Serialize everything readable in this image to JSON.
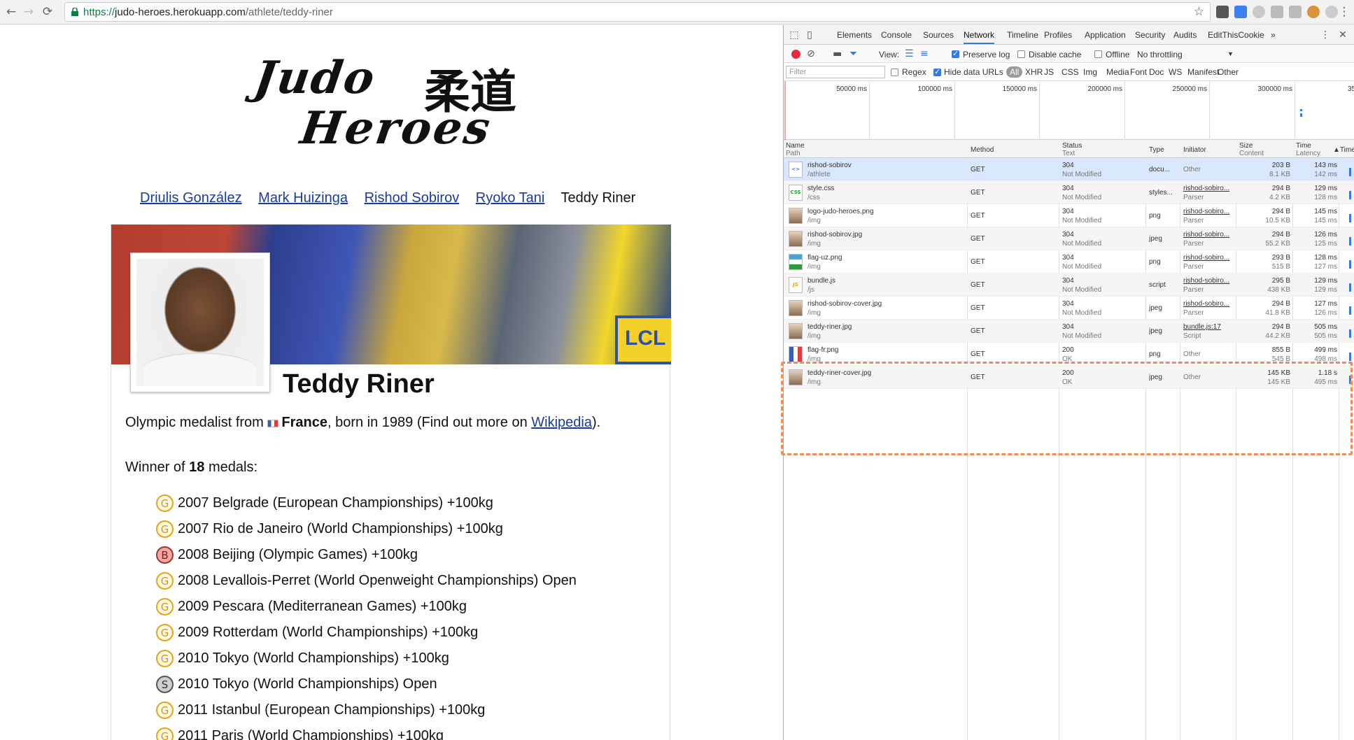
{
  "browser": {
    "url_scheme": "https://",
    "url_host": "judo-heroes.herokuapp.com",
    "url_path": "/athlete/teddy-riner"
  },
  "page": {
    "logo": {
      "line1": "Judo",
      "line2": "Heroes",
      "kanji": "柔道"
    },
    "athlete_links": [
      "Driulis González",
      "Mark Huizinga",
      "Rishod Sobirov",
      "Ryoko Tani"
    ],
    "current_athlete": "Teddy Riner",
    "cover_banner_text": "LCL",
    "name": "Teddy Riner",
    "intro": {
      "prefix": "Olympic medalist from",
      "country": "France",
      "middle": ", born in 1989 (Find out more on",
      "link": "Wikipedia",
      "suffix": ")."
    },
    "winner": {
      "prefix": "Winner of",
      "count": "18",
      "suffix": "medals:"
    },
    "medals": [
      {
        "type": "G",
        "text": "2007 Belgrade (European Championships) +100kg"
      },
      {
        "type": "G",
        "text": "2007 Rio de Janeiro (World Championships) +100kg"
      },
      {
        "type": "B",
        "text": "2008 Beijing (Olympic Games) +100kg"
      },
      {
        "type": "G",
        "text": "2008 Levallois-Perret (World Openweight Championships) Open"
      },
      {
        "type": "G",
        "text": "2009 Pescara (Mediterranean Games) +100kg"
      },
      {
        "type": "G",
        "text": "2009 Rotterdam (World Championships) +100kg"
      },
      {
        "type": "G",
        "text": "2010 Tokyo (World Championships) +100kg"
      },
      {
        "type": "S",
        "text": "2010 Tokyo (World Championships) Open"
      },
      {
        "type": "G",
        "text": "2011 Istanbul (European Championships) +100kg"
      },
      {
        "type": "G",
        "text": "2011 Paris (World Championships) +100kg"
      }
    ]
  },
  "devtools": {
    "tabs": [
      "Elements",
      "Console",
      "Sources",
      "Network",
      "Timeline",
      "Profiles",
      "Application",
      "Security",
      "Audits",
      "EditThisCookie"
    ],
    "active_tab": "Network",
    "more_tabs": "»",
    "toolbar": {
      "view_label": "View:",
      "preserve_log": "Preserve log",
      "disable_cache": "Disable cache",
      "offline": "Offline",
      "throttling": "No throttling"
    },
    "filter": {
      "placeholder": "Filter",
      "regex": "Regex",
      "hide_data_urls": "Hide data URLs",
      "types": [
        "All",
        "XHR",
        "JS",
        "CSS",
        "Img",
        "Media",
        "Font",
        "Doc",
        "WS",
        "Manifest",
        "Other"
      ]
    },
    "timeline_ticks": [
      "50000 ms",
      "100000 ms",
      "150000 ms",
      "200000 ms",
      "250000 ms",
      "300000 ms",
      "35"
    ],
    "columns": {
      "name": "Name",
      "path": "Path",
      "method": "Method",
      "status": "Status",
      "text": "Text",
      "type": "Type",
      "initiator": "Initiator",
      "size": "Size",
      "content": "Content",
      "time": "Time",
      "latency": "Latency",
      "timeline": "Time"
    },
    "requests": [
      {
        "name": "rishod-sobirov",
        "path": "/athlete",
        "method": "GET",
        "status": "304",
        "status_text": "Not Modified",
        "type": "docu...",
        "initiator": "Other",
        "initiator_sub": "",
        "size": "203 B",
        "content": "8.1 KB",
        "time": "143 ms",
        "latency": "142 ms",
        "icon": "doc"
      },
      {
        "name": "style.css",
        "path": "/css",
        "method": "GET",
        "status": "304",
        "status_text": "Not Modified",
        "type": "styles...",
        "initiator": "rishod-sobiro...",
        "initiator_sub": "Parser",
        "size": "294 B",
        "content": "4.2 KB",
        "time": "129 ms",
        "latency": "128 ms",
        "icon": "css"
      },
      {
        "name": "logo-judo-heroes.png",
        "path": "/img",
        "method": "GET",
        "status": "304",
        "status_text": "Not Modified",
        "type": "png",
        "initiator": "rishod-sobiro...",
        "initiator_sub": "Parser",
        "size": "294 B",
        "content": "10.5 KB",
        "time": "145 ms",
        "latency": "145 ms",
        "icon": "img"
      },
      {
        "name": "rishod-sobirov.jpg",
        "path": "/img",
        "method": "GET",
        "status": "304",
        "status_text": "Not Modified",
        "type": "jpeg",
        "initiator": "rishod-sobiro...",
        "initiator_sub": "Parser",
        "size": "294 B",
        "content": "55.2 KB",
        "time": "126 ms",
        "latency": "125 ms",
        "icon": "img"
      },
      {
        "name": "flag-uz.png",
        "path": "/img",
        "method": "GET",
        "status": "304",
        "status_text": "Not Modified",
        "type": "png",
        "initiator": "rishod-sobiro...",
        "initiator_sub": "Parser",
        "size": "293 B",
        "content": "515 B",
        "time": "128 ms",
        "latency": "127 ms",
        "icon": "flag-uz"
      },
      {
        "name": "bundle.js",
        "path": "/js",
        "method": "GET",
        "status": "304",
        "status_text": "Not Modified",
        "type": "script",
        "initiator": "rishod-sobiro...",
        "initiator_sub": "Parser",
        "size": "295 B",
        "content": "438 KB",
        "time": "129 ms",
        "latency": "129 ms",
        "icon": "js"
      },
      {
        "name": "rishod-sobirov-cover.jpg",
        "path": "/img",
        "method": "GET",
        "status": "304",
        "status_text": "Not Modified",
        "type": "jpeg",
        "initiator": "rishod-sobiro...",
        "initiator_sub": "Parser",
        "size": "294 B",
        "content": "41.8 KB",
        "time": "127 ms",
        "latency": "126 ms",
        "icon": "img"
      },
      {
        "name": "teddy-riner.jpg",
        "path": "/img",
        "method": "GET",
        "status": "304",
        "status_text": "Not Modified",
        "type": "jpeg",
        "initiator": "bundle.js:17",
        "initiator_sub": "Script",
        "size": "294 B",
        "content": "44.2 KB",
        "time": "505 ms",
        "latency": "505 ms",
        "icon": "img"
      },
      {
        "name": "flag-fr.png",
        "path": "/img",
        "method": "GET",
        "status": "200",
        "status_text": "OK",
        "type": "png",
        "initiator": "Other",
        "initiator_sub": "",
        "size": "855 B",
        "content": "545 B",
        "time": "499 ms",
        "latency": "498 ms",
        "icon": "flag-fr"
      },
      {
        "name": "teddy-riner-cover.jpg",
        "path": "/img",
        "method": "GET",
        "status": "200",
        "status_text": "OK",
        "type": "jpeg",
        "initiator": "Other",
        "initiator_sub": "",
        "size": "145 KB",
        "content": "145 KB",
        "time": "1.18 s",
        "latency": "495 ms",
        "icon": "img"
      }
    ]
  },
  "colors": {
    "link": "#1a3a9e",
    "devtools_accent": "#3879d9",
    "record": "#e8283e",
    "highlight": "#f08c5a"
  }
}
